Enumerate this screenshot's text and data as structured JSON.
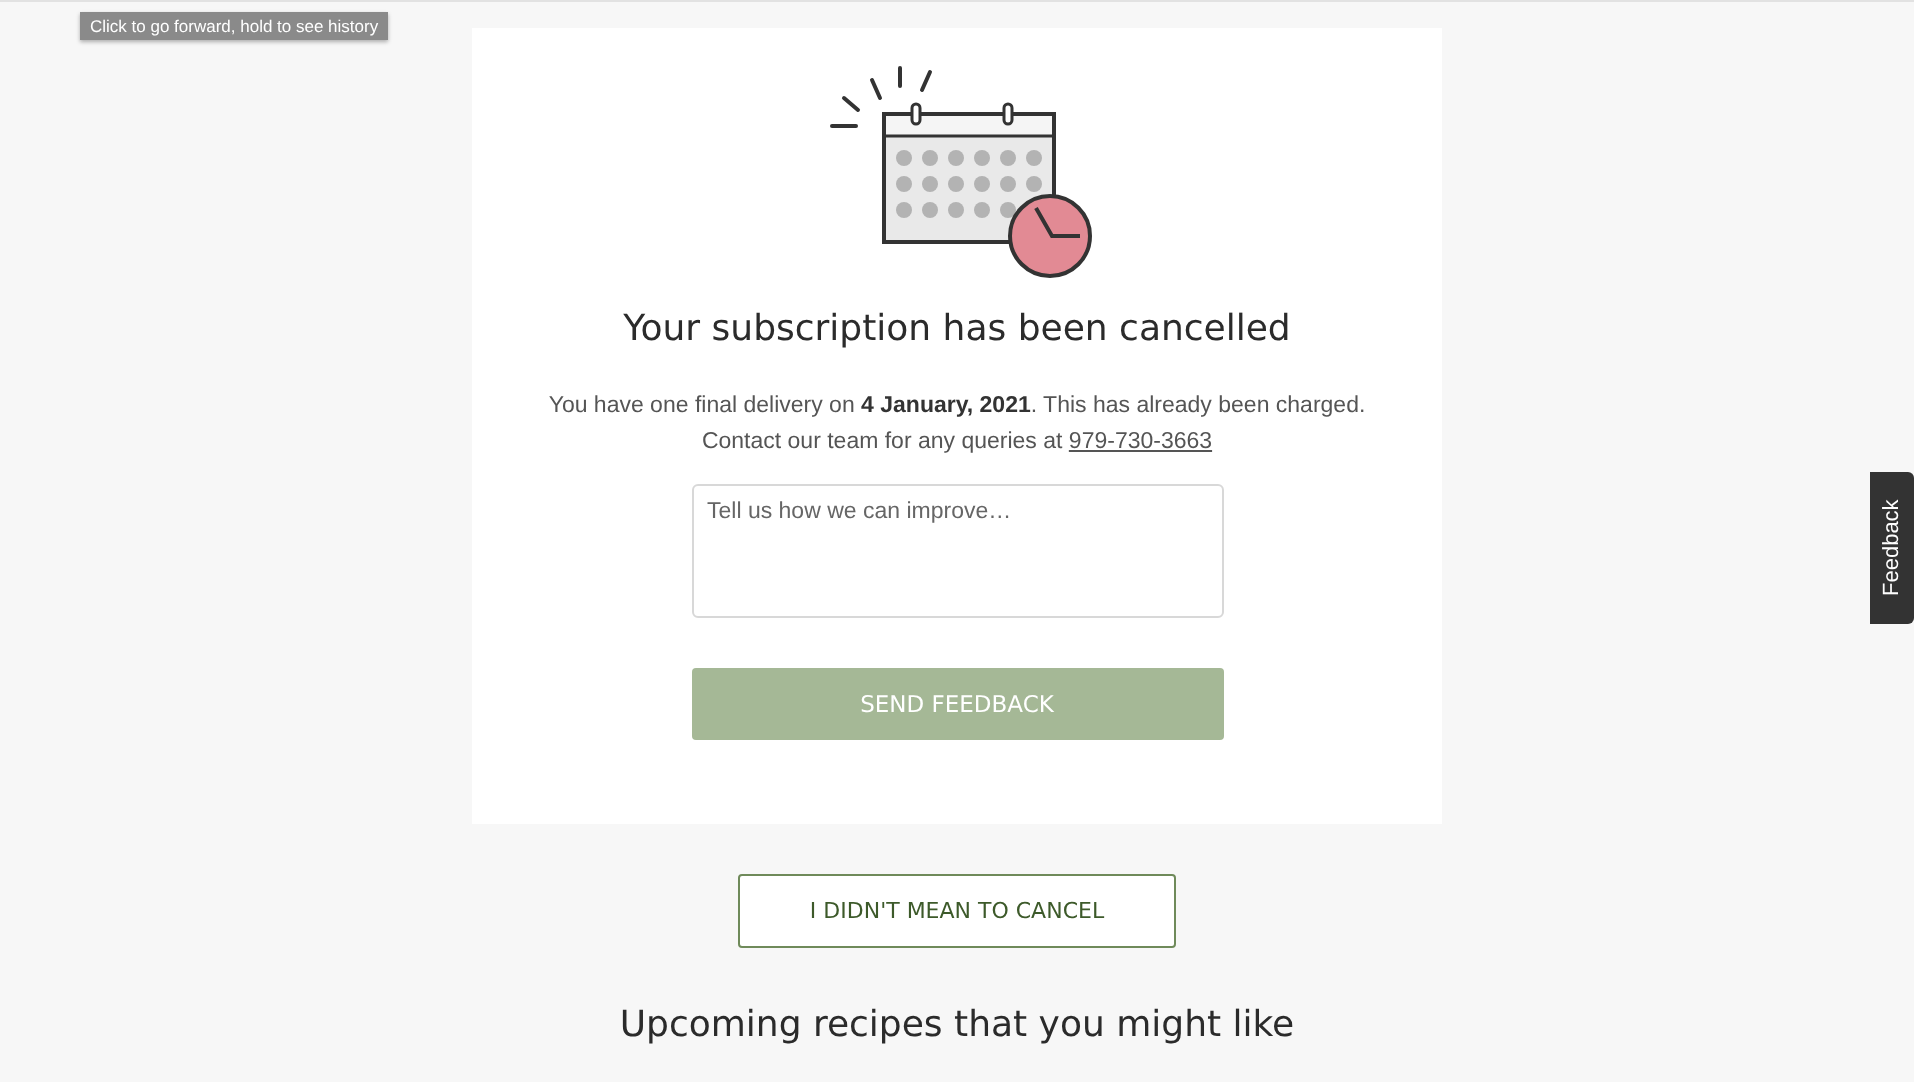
{
  "tooltip": "Click to go forward, hold to see history",
  "card": {
    "title": "Your subscription has been cancelled",
    "message": "You have one final delivery on **4 January, 2021**. This has already been charged.",
    "contact_text": "Contact our team for any queries at",
    "phone": "979-730-3663",
    "feedback_field": {
      "placeholder": "Tell us how we can improve…"
    },
    "send_button": "SEND FEEDBACK"
  },
  "undo_button": "I DIDN'T MEAN TO CANCEL",
  "recipes_heading": "Upcoming recipes that you might like",
  "feedback_tab": "Feedback"
}
